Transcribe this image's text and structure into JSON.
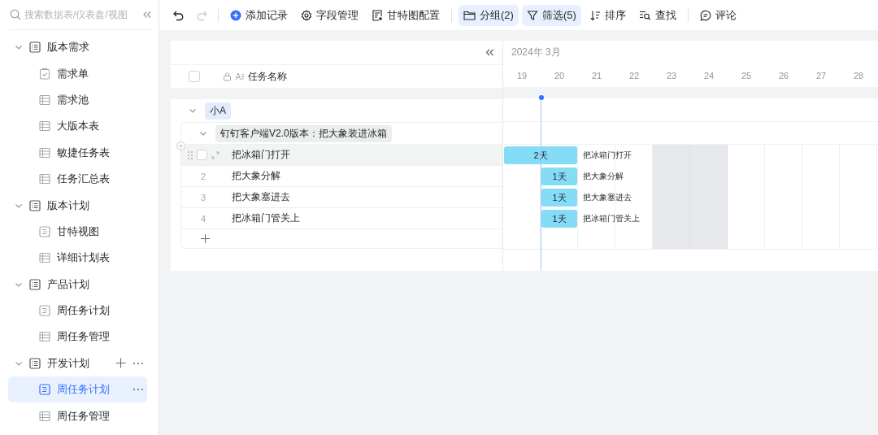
{
  "sidebar": {
    "search": {
      "placeholder": "搜索数据表/仪表盘/视图"
    },
    "tree": [
      {
        "label": "版本需求",
        "kind": "folder",
        "expanded": true,
        "hovered": false,
        "children": [
          {
            "label": "需求单",
            "kind": "form",
            "selected": false
          },
          {
            "label": "需求池",
            "kind": "table",
            "selected": false
          },
          {
            "label": "大版本表",
            "kind": "table",
            "selected": false
          },
          {
            "label": "敏捷任务表",
            "kind": "table",
            "selected": false
          },
          {
            "label": "任务汇总表",
            "kind": "table",
            "selected": false
          }
        ]
      },
      {
        "label": "版本计划",
        "kind": "folder",
        "expanded": true,
        "hovered": false,
        "children": [
          {
            "label": "甘特视图",
            "kind": "gantt",
            "selected": false
          },
          {
            "label": "详细计划表",
            "kind": "table",
            "selected": false
          }
        ]
      },
      {
        "label": "产品计划",
        "kind": "folder",
        "expanded": true,
        "hovered": false,
        "children": [
          {
            "label": "周任务计划",
            "kind": "gantt",
            "selected": false
          },
          {
            "label": "周任务管理",
            "kind": "table",
            "selected": false
          }
        ]
      },
      {
        "label": "开发计划",
        "kind": "folder",
        "expanded": true,
        "hovered": true,
        "children": [
          {
            "label": "周任务计划",
            "kind": "gantt",
            "selected": true
          },
          {
            "label": "周任务管理",
            "kind": "table",
            "selected": false
          }
        ]
      }
    ]
  },
  "toolbar": [
    {
      "kind": "undo",
      "disabled": false
    },
    {
      "kind": "redo",
      "disabled": true
    },
    {
      "kind": "divider"
    },
    {
      "kind": "add",
      "label": "添加记录",
      "active": false
    },
    {
      "kind": "fields",
      "label": "字段管理",
      "active": false
    },
    {
      "kind": "gantt-config",
      "label": "甘特图配置",
      "active": false
    },
    {
      "kind": "divider"
    },
    {
      "kind": "group",
      "label": "分组(2)",
      "active": true
    },
    {
      "kind": "filter",
      "label": "筛选(5)",
      "active": true
    },
    {
      "kind": "sort",
      "label": "排序",
      "active": false
    },
    {
      "kind": "find",
      "label": "查找",
      "active": false
    },
    {
      "kind": "divider"
    },
    {
      "kind": "comment",
      "label": "评论",
      "active": false
    }
  ],
  "table": {
    "select_all_checked": false,
    "column": "任务名称",
    "group": {
      "label": "小A",
      "expanded": true,
      "subgroup": {
        "label": "钉钉客户端V2.0版本：把大象装进冰箱",
        "expanded": true,
        "tasks": [
          {
            "name": "把冰箱门打开",
            "hovered": true
          },
          {
            "number": "2",
            "name": "把大象分解",
            "hovered": false
          },
          {
            "number": "3",
            "name": "把大象塞进去",
            "hovered": false
          },
          {
            "number": "4",
            "name": "把冰箱门管关上",
            "hovered": false
          }
        ]
      }
    }
  },
  "gantt": {
    "month": "2024年 3月",
    "days": [
      {
        "label": "19",
        "weekend": false
      },
      {
        "label": "20",
        "weekend": false
      },
      {
        "label": "21",
        "weekend": false
      },
      {
        "label": "22",
        "weekend": false
      },
      {
        "label": "23",
        "weekend": true
      },
      {
        "label": "24",
        "weekend": true
      },
      {
        "label": "25",
        "weekend": false
      },
      {
        "label": "26",
        "weekend": false
      },
      {
        "label": "27",
        "weekend": false
      },
      {
        "label": "28",
        "weekend": false
      }
    ],
    "bars": [
      {
        "duration": "2天",
        "label": "把冰箱门打开"
      },
      {
        "duration": "1天",
        "label": "把大象分解"
      },
      {
        "duration": "1天",
        "label": "把大象塞进去"
      },
      {
        "duration": "1天",
        "label": "把冰箱门管关上"
      }
    ]
  }
}
